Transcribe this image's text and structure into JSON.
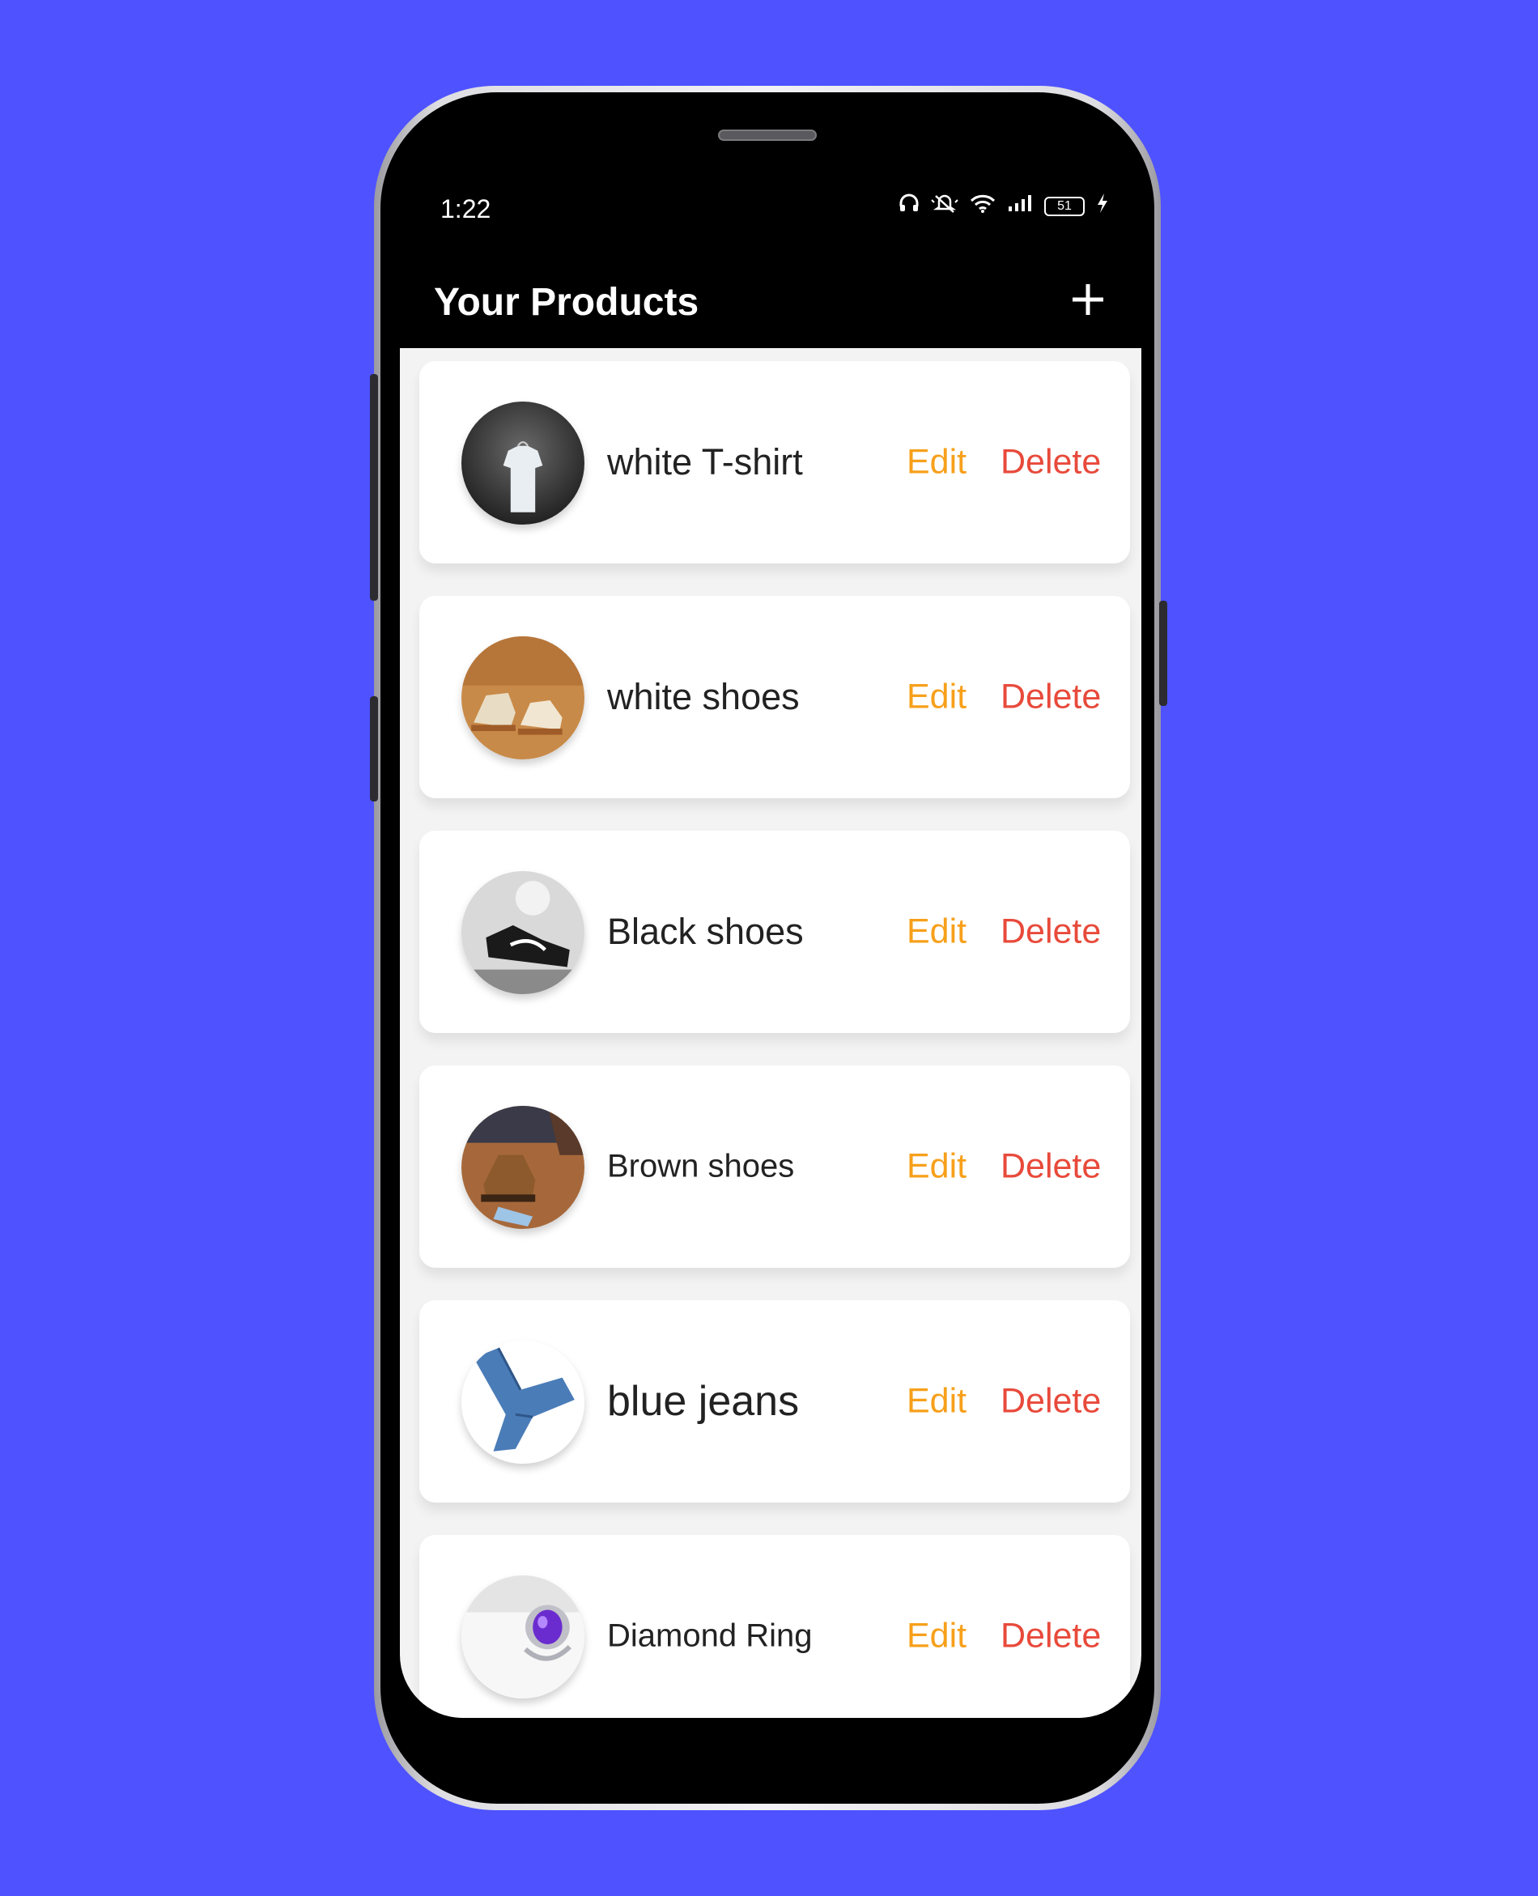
{
  "status_bar": {
    "time": "1:22",
    "battery": "51",
    "icons": [
      "headphones-icon",
      "mute-icon",
      "wifi-icon",
      "signal-icon",
      "battery-icon",
      "charging-icon"
    ]
  },
  "app_bar": {
    "title": "Your Products",
    "add_icon": "plus-icon"
  },
  "colors": {
    "background": "#4f52ff",
    "edit": "#f7a01b",
    "delete": "#e84a3b"
  },
  "products": [
    {
      "name": "white T-shirt",
      "edit_label": "Edit",
      "delete_label": "Delete",
      "image": "t-shirt-photo"
    },
    {
      "name": "white shoes",
      "edit_label": "Edit",
      "delete_label": "Delete",
      "image": "white-shoes-photo"
    },
    {
      "name": "Black shoes",
      "edit_label": "Edit",
      "delete_label": "Delete",
      "image": "black-shoes-photo"
    },
    {
      "name": "Brown shoes",
      "edit_label": "Edit",
      "delete_label": "Delete",
      "image": "brown-shoes-photo"
    },
    {
      "name": "blue jeans",
      "edit_label": "Edit",
      "delete_label": "Delete",
      "image": "jeans-photo"
    },
    {
      "name": "Diamond Ring",
      "edit_label": "Edit",
      "delete_label": "Delete",
      "image": "ring-photo"
    }
  ]
}
